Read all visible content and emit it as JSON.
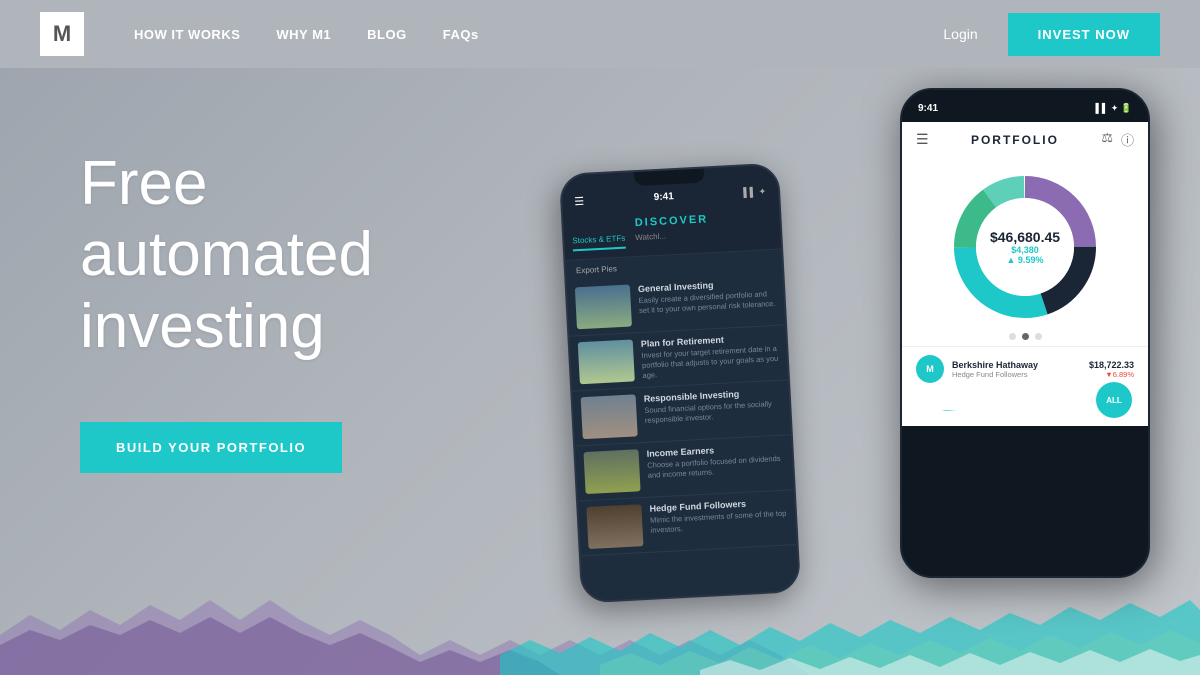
{
  "nav": {
    "logo": "M",
    "links": [
      {
        "label": "HOW IT WORKS",
        "id": "how-it-works"
      },
      {
        "label": "WHY M1",
        "id": "why-m1"
      },
      {
        "label": "BLOG",
        "id": "blog"
      },
      {
        "label": "FAQs",
        "id": "faqs"
      }
    ],
    "login_label": "Login",
    "invest_label": "INVEST NOW"
  },
  "hero": {
    "headline_line1": "Free",
    "headline_line2": "automated",
    "headline_line3": "investing",
    "cta_label": "BUILD YOUR PORTFOLIO"
  },
  "phone1": {
    "time": "9:41",
    "title": "DISCOVER",
    "tab1": "Stocks & ETFs",
    "tab2": "Watchl...",
    "export_label": "Export Pies",
    "items": [
      {
        "title": "General Investing",
        "desc": "Easily create a diversified portfolio and set it to your own personal risk tolerance.",
        "img": "mountain"
      },
      {
        "title": "Plan for Retirement",
        "desc": "Invest for your target retirement date in a portfolio that adjusts to your goals as you age.",
        "img": "vacation"
      },
      {
        "title": "Responsible Investing",
        "desc": "Sound financial options for the socially responsible investor.",
        "img": "city"
      },
      {
        "title": "Income Earners",
        "desc": "Choose a portfolio focused on dividends and income returns.",
        "img": "money"
      },
      {
        "title": "Hedge Fund Followers",
        "desc": "Mimic the investments of some of the top investors.",
        "img": "bull"
      }
    ]
  },
  "phone2": {
    "time": "9:41",
    "title": "PORTFOLIO",
    "portfolio_value": "$46,680.45",
    "portfolio_gain": "$4,380",
    "portfolio_pct": "▲ 9.59%",
    "stock": {
      "symbol": "M",
      "name": "Berkshire Hathaway",
      "sub": "Hedge Fund Followers",
      "price": "$18,722.33",
      "change": "▼6.89%"
    },
    "all_label": "ALL"
  },
  "colors": {
    "teal": "#1ec8c8",
    "dark_navy": "#1a2535",
    "purple": "#8b6bb1",
    "dark_teal": "#2a7a6a",
    "light_teal": "#5ecfb8",
    "green": "#3dba8a"
  }
}
